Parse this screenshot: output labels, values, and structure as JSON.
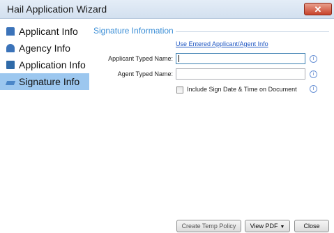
{
  "window": {
    "title": "Hail Application Wizard",
    "close_symbol": "✕"
  },
  "nav": {
    "items": [
      {
        "label": "Applicant Info",
        "icon": "building-icon"
      },
      {
        "label": "Agency Info",
        "icon": "person-icon"
      },
      {
        "label": "Application Info",
        "icon": "document-icon"
      },
      {
        "label": "Signature Info",
        "icon": "pen-icon",
        "active": true
      }
    ]
  },
  "section": {
    "title": "Signature Information",
    "use_entered_link": "Use Entered Applicant/Agent Info",
    "applicant_label": "Applicant Typed Name:",
    "applicant_value": "",
    "agent_label": "Agent Typed Name:",
    "agent_value": "",
    "include_date_label": "Include Sign Date & Time on Document",
    "info_glyph": "i"
  },
  "buttons": {
    "create_temp": "Create Temp Policy",
    "view_pdf": "View PDF",
    "close": "Close"
  }
}
